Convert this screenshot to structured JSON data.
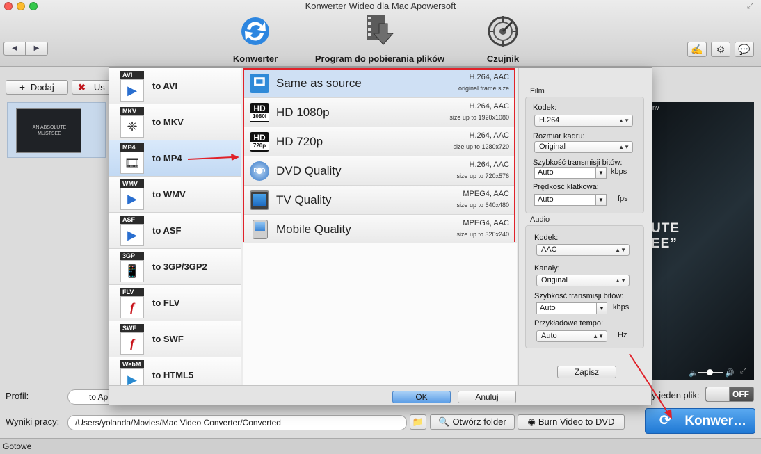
{
  "window": {
    "title": "Konwerter Wideo dla Mac Apowersoft"
  },
  "toolbar": {
    "back_label": "◀",
    "forward_label": "▶",
    "items": [
      {
        "label": "Konwerter",
        "icon": "converter-icon"
      },
      {
        "label": "Program do pobierania plików",
        "icon": "download-icon"
      },
      {
        "label": "Czujnik",
        "icon": "sensor-icon"
      }
    ],
    "right_icons": [
      "user-tools-icon",
      "gear-icon",
      "chat-icon"
    ]
  },
  "main": {
    "add_button": "Dodaj",
    "remove_button": "Us",
    "thumbnail_text": "AN ABSOLUTE MUSTSEE",
    "preview_text": "UTE\nEE”",
    "preview_label": "nv",
    "profile_label": "Profil:",
    "profile_value": "to Ap",
    "merge_label": "y jeden plik:",
    "merge_toggle": "OFF",
    "output_label": "Wyniki pracy:",
    "output_path": "/Users/yolanda/Movies/Mac Video Converter/Converted",
    "open_folder_button": "Otwórz folder",
    "burn_button": "Burn Video to DVD",
    "convert_button": "Konwer…",
    "status": "Gotowe"
  },
  "dialog": {
    "formats": [
      {
        "badge": "AVI",
        "label": "to AVI"
      },
      {
        "badge": "MKV",
        "label": "to MKV"
      },
      {
        "badge": "MP4",
        "label": "to MP4",
        "selected": true
      },
      {
        "badge": "WMV",
        "label": "to WMV"
      },
      {
        "badge": "ASF",
        "label": "to ASF"
      },
      {
        "badge": "3GP",
        "label": "to 3GP/3GP2"
      },
      {
        "badge": "FLV",
        "label": "to FLV"
      },
      {
        "badge": "SWF",
        "label": "to SWF"
      },
      {
        "badge": "WebM",
        "label": "to HTML5"
      }
    ],
    "presets": [
      {
        "name": "Same as source",
        "codec": "H.264, AAC",
        "desc": "original frame size",
        "icon": "film-strip-icon",
        "selected": true
      },
      {
        "name": "HD 1080p",
        "codec": "H.264, AAC",
        "desc": "size up to 1920x1080",
        "icon": "hd-1080-icon",
        "badge_top": "HD",
        "badge_bottom": "1080i"
      },
      {
        "name": "HD 720p",
        "codec": "H.264, AAC",
        "desc": "size up to 1280x720",
        "icon": "hd-720-icon",
        "badge_top": "HD",
        "badge_bottom": "720p"
      },
      {
        "name": "DVD Quality",
        "codec": "H.264, AAC",
        "desc": "size up to 720x576",
        "icon": "dvd-icon",
        "badge_top": "DVD"
      },
      {
        "name": "TV Quality",
        "codec": "MPEG4, AAC",
        "desc": "size up to 640x480",
        "icon": "tv-icon"
      },
      {
        "name": "Mobile Quality",
        "codec": "MPEG4, AAC",
        "desc": "size up to 320x240",
        "icon": "mobile-icon"
      }
    ],
    "film": {
      "group_label": "Film",
      "codec_label": "Kodek:",
      "codec_value": "H.264",
      "frame_label": "Rozmiar kadru:",
      "frame_value": "Original",
      "bitrate_label": "Szybkość transmisji bitów:",
      "bitrate_value": "Auto",
      "bitrate_unit": "kbps",
      "fps_label": "Prędkość klatkowa:",
      "fps_value": "Auto",
      "fps_unit": "fps"
    },
    "audio": {
      "group_label": "Audio",
      "codec_label": "Kodek:",
      "codec_value": "AAC",
      "channels_label": "Kanały:",
      "channels_value": "Original",
      "bitrate_label": "Szybkość transmisji bitów:",
      "bitrate_value": "Auto",
      "bitrate_unit": "kbps",
      "rate_label": "Przykładowe tempo:",
      "rate_value": "Auto",
      "rate_unit": "Hz"
    },
    "save_button": "Zapisz",
    "ok_button": "OK",
    "cancel_button": "Anuluj"
  },
  "colors": {
    "accent": "#1f78d4",
    "highlight": "#e0222a"
  }
}
